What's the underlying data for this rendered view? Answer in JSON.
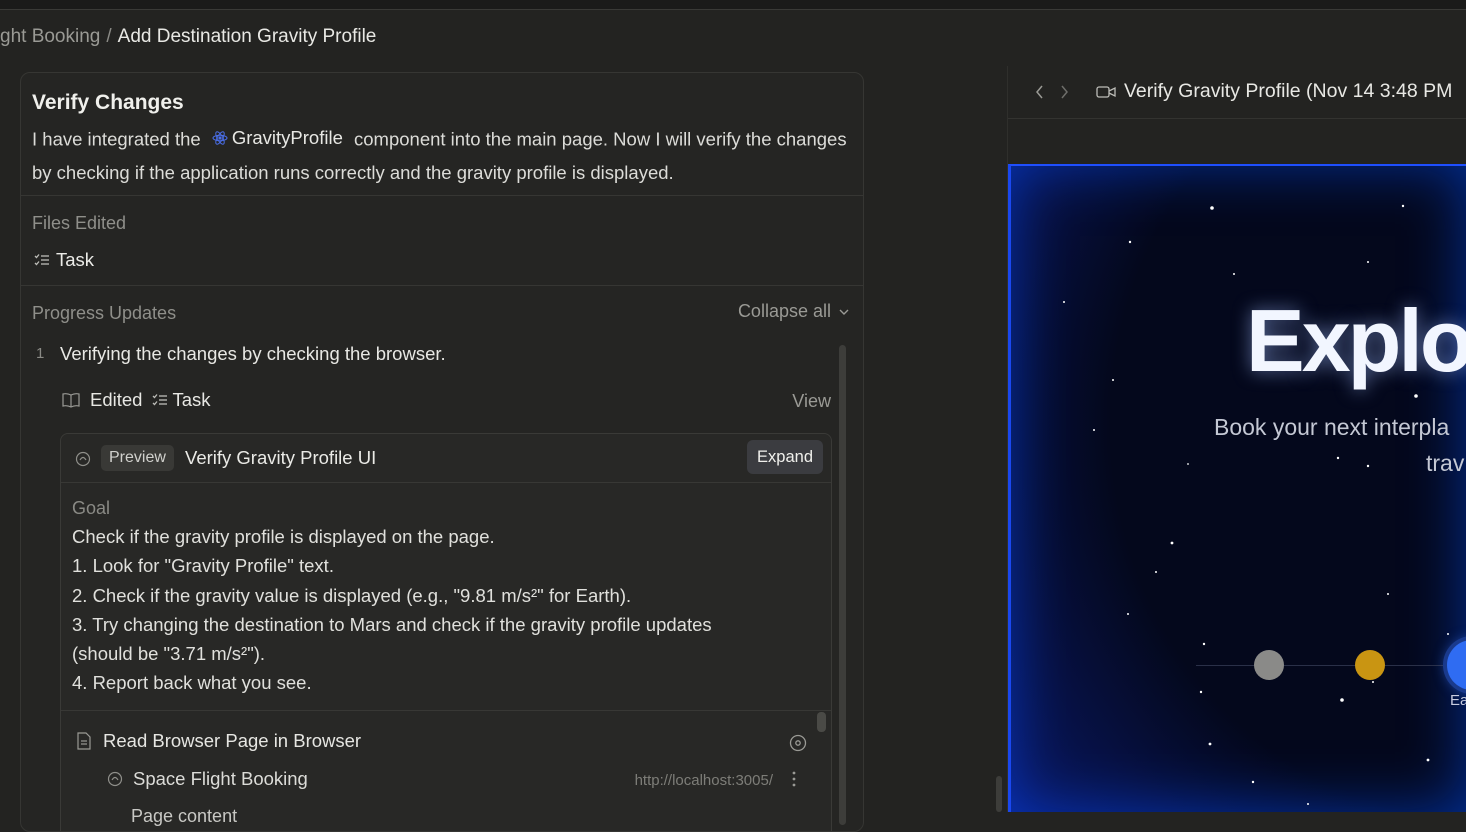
{
  "breadcrumb": {
    "parent": "ght Booking",
    "separator": "/",
    "current": "Add Destination Gravity Profile"
  },
  "step": {
    "title": "Verify Changes",
    "desc_before": "I have integrated the",
    "component": "GravityProfile",
    "desc_after": "component into the main page. Now I will verify the changes by checking if the application runs correctly and the gravity profile is displayed."
  },
  "files_edited": {
    "label": "Files Edited",
    "file": "Task"
  },
  "progress": {
    "label": "Progress Updates",
    "collapse_all": "Collapse all",
    "items": [
      {
        "num": "1",
        "text": "Verifying the changes by checking the browser.",
        "edited_label": "Edited",
        "edited_file": "Task",
        "view": "View"
      }
    ]
  },
  "subtask": {
    "badge": "Preview",
    "title": "Verify Gravity Profile UI",
    "expand": "Expand",
    "goal_label": "Goal",
    "goal_lines": [
      "Check if the gravity profile is displayed on the page.",
      "1. Look for \"Gravity Profile\" text.",
      "2. Check if the gravity value is displayed (e.g., \"9.81 m/s²\" for Earth).",
      "3. Try changing the destination to Mars and check if the gravity profile updates",
      "(should be \"3.71 m/s²\").",
      "4. Report back what you see."
    ],
    "action": "Read Browser Page in Browser",
    "site_name": "Space Flight Booking",
    "site_url": "http://localhost:3005/",
    "cutoff": "Page content"
  },
  "recording": {
    "title": "Verify Gravity Profile (Nov 14 3:48 PM"
  },
  "browser_page": {
    "hero_title": "Explor",
    "hero_sub1": "Book your next interpla",
    "hero_sub2": "trav",
    "planet_label": "Ea"
  },
  "colors": {
    "app_bg": "#232321",
    "card_bg": "#252523",
    "accent_blue": "#2f6cf2",
    "planet_gray": "#8a8a88",
    "planet_gold": "#c99512"
  }
}
